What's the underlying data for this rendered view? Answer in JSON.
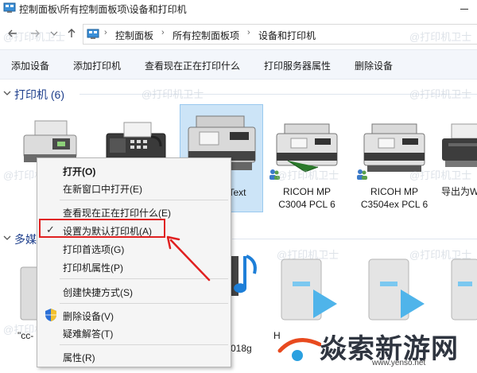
{
  "window": {
    "title": "控制面板\\所有控制面板项\\设备和打印机"
  },
  "address": {
    "crumbs": [
      "控制面板",
      "所有控制面板项",
      "设备和打印机"
    ]
  },
  "toolbar": {
    "add_device": "添加设备",
    "add_printer": "添加打印机",
    "see_printing": "查看现在正在打印什么",
    "print_server": "打印服务器属性",
    "remove_device": "删除设备"
  },
  "groups": {
    "printers_title": "打印机 (6)",
    "multimedia_title": "多媒"
  },
  "printers": [
    {
      "label_line1": "",
      "label_line2": ""
    },
    {
      "label_line1": "",
      "label_line2": ""
    },
    {
      "label_line1": "Text",
      "label_line2": ""
    },
    {
      "label_line1": "RICOH MP",
      "label_line2": "C3004 PCL 6"
    },
    {
      "label_line1": "RICOH MP",
      "label_line2": "C3504ex PCL 6"
    },
    {
      "label_line1": "导出为W",
      "label_line2": ""
    }
  ],
  "printer_partial_labels": {
    "left1": "E",
    "left2": "H"
  },
  "media": [
    {
      "label": "\"cc-"
    },
    {
      "label": "018g"
    },
    {
      "label": "H"
    }
  ],
  "context_menu": {
    "open": "打开(O)",
    "open_new": "在新窗口中打开(E)",
    "see_printing": "查看现在正在打印什么(E)",
    "set_default": "设置为默认打印机(A)",
    "prefs": "打印首选项(G)",
    "props": "打印机属性(P)",
    "shortcut": "创建快捷方式(S)",
    "remove": "删除设备(V)",
    "troubleshoot": "疑难解答(T)",
    "properties": "属性(R)"
  },
  "watermark": {
    "text": "@打印机卫士"
  },
  "logo": {
    "text": "焱索新游网",
    "url": "www.yenso.net"
  },
  "colors": {
    "group_title": "#1e3f8c",
    "selection": "#cce4f7",
    "highlight": "#e02020",
    "commandbar": "#f3f6fb"
  }
}
